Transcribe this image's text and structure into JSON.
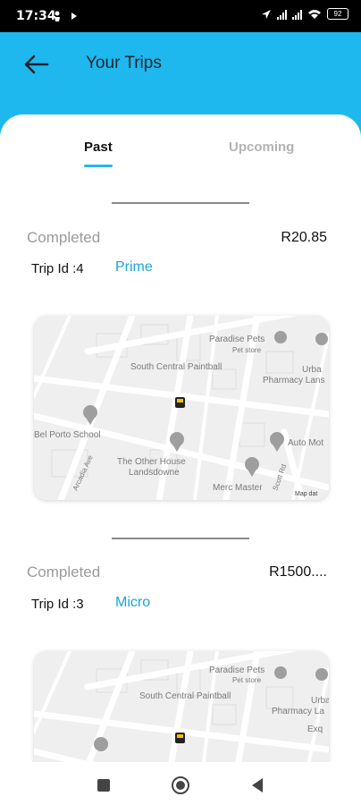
{
  "status_bar": {
    "time": "17:34",
    "battery": "92"
  },
  "header": {
    "title": "Your Trips",
    "back_icon": "arrow-left-icon"
  },
  "tabs": [
    {
      "label": "Past",
      "active": true
    },
    {
      "label": "Upcoming",
      "active": false
    }
  ],
  "trips": [
    {
      "status": "Completed",
      "price": "R20.85",
      "trip_id": "Trip Id :4",
      "ride_type": "Prime",
      "map": {
        "labels": [
          "Paradise Pets",
          "Pet store",
          "South Central Paintball",
          "Urba",
          "Pharmacy Lans",
          "Bel Porto School",
          "The Other House",
          "Landsdowne",
          "Merc Master",
          "Auto Mot",
          "Arcadia Ave",
          "Scott Rd",
          "Map dat"
        ]
      }
    },
    {
      "status": "Completed",
      "price": "R1500....",
      "trip_id": "Trip Id :3",
      "ride_type": "Micro",
      "map": {
        "labels": [
          "Paradise Pets",
          "Pet store",
          "South Central Paintball",
          "Urba",
          "Pharmacy La",
          "Exq"
        ]
      }
    }
  ],
  "colors": {
    "accent": "#1fb8ee",
    "ride_type": "#1aa6d8",
    "status": "#9a9a9a"
  },
  "nav_icons": [
    "square-recents-icon",
    "circle-home-icon",
    "triangle-back-icon"
  ]
}
